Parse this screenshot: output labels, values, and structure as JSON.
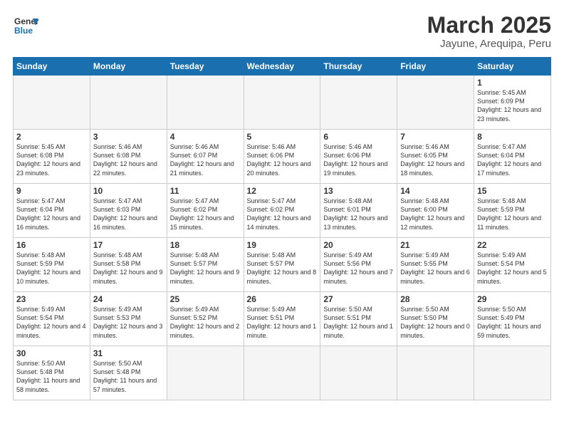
{
  "header": {
    "logo_general": "General",
    "logo_blue": "Blue",
    "month_year": "March 2025",
    "location": "Jayune, Arequipa, Peru"
  },
  "weekdays": [
    "Sunday",
    "Monday",
    "Tuesday",
    "Wednesday",
    "Thursday",
    "Friday",
    "Saturday"
  ],
  "weeks": [
    [
      {
        "day": "",
        "info": ""
      },
      {
        "day": "",
        "info": ""
      },
      {
        "day": "",
        "info": ""
      },
      {
        "day": "",
        "info": ""
      },
      {
        "day": "",
        "info": ""
      },
      {
        "day": "",
        "info": ""
      },
      {
        "day": "1",
        "info": "Sunrise: 5:45 AM\nSunset: 6:09 PM\nDaylight: 12 hours and 23 minutes."
      }
    ],
    [
      {
        "day": "2",
        "info": "Sunrise: 5:45 AM\nSunset: 6:08 PM\nDaylight: 12 hours and 23 minutes."
      },
      {
        "day": "3",
        "info": "Sunrise: 5:46 AM\nSunset: 6:08 PM\nDaylight: 12 hours and 22 minutes."
      },
      {
        "day": "4",
        "info": "Sunrise: 5:46 AM\nSunset: 6:07 PM\nDaylight: 12 hours and 21 minutes."
      },
      {
        "day": "5",
        "info": "Sunrise: 5:46 AM\nSunset: 6:06 PM\nDaylight: 12 hours and 20 minutes."
      },
      {
        "day": "6",
        "info": "Sunrise: 5:46 AM\nSunset: 6:06 PM\nDaylight: 12 hours and 19 minutes."
      },
      {
        "day": "7",
        "info": "Sunrise: 5:46 AM\nSunset: 6:05 PM\nDaylight: 12 hours and 18 minutes."
      },
      {
        "day": "8",
        "info": "Sunrise: 5:47 AM\nSunset: 6:04 PM\nDaylight: 12 hours and 17 minutes."
      }
    ],
    [
      {
        "day": "9",
        "info": "Sunrise: 5:47 AM\nSunset: 6:04 PM\nDaylight: 12 hours and 16 minutes."
      },
      {
        "day": "10",
        "info": "Sunrise: 5:47 AM\nSunset: 6:03 PM\nDaylight: 12 hours and 16 minutes."
      },
      {
        "day": "11",
        "info": "Sunrise: 5:47 AM\nSunset: 6:02 PM\nDaylight: 12 hours and 15 minutes."
      },
      {
        "day": "12",
        "info": "Sunrise: 5:47 AM\nSunset: 6:02 PM\nDaylight: 12 hours and 14 minutes."
      },
      {
        "day": "13",
        "info": "Sunrise: 5:48 AM\nSunset: 6:01 PM\nDaylight: 12 hours and 13 minutes."
      },
      {
        "day": "14",
        "info": "Sunrise: 5:48 AM\nSunset: 6:00 PM\nDaylight: 12 hours and 12 minutes."
      },
      {
        "day": "15",
        "info": "Sunrise: 5:48 AM\nSunset: 5:59 PM\nDaylight: 12 hours and 11 minutes."
      }
    ],
    [
      {
        "day": "16",
        "info": "Sunrise: 5:48 AM\nSunset: 5:59 PM\nDaylight: 12 hours and 10 minutes."
      },
      {
        "day": "17",
        "info": "Sunrise: 5:48 AM\nSunset: 5:58 PM\nDaylight: 12 hours and 9 minutes."
      },
      {
        "day": "18",
        "info": "Sunrise: 5:48 AM\nSunset: 5:57 PM\nDaylight: 12 hours and 9 minutes."
      },
      {
        "day": "19",
        "info": "Sunrise: 5:48 AM\nSunset: 5:57 PM\nDaylight: 12 hours and 8 minutes."
      },
      {
        "day": "20",
        "info": "Sunrise: 5:49 AM\nSunset: 5:56 PM\nDaylight: 12 hours and 7 minutes."
      },
      {
        "day": "21",
        "info": "Sunrise: 5:49 AM\nSunset: 5:55 PM\nDaylight: 12 hours and 6 minutes."
      },
      {
        "day": "22",
        "info": "Sunrise: 5:49 AM\nSunset: 5:54 PM\nDaylight: 12 hours and 5 minutes."
      }
    ],
    [
      {
        "day": "23",
        "info": "Sunrise: 5:49 AM\nSunset: 5:54 PM\nDaylight: 12 hours and 4 minutes."
      },
      {
        "day": "24",
        "info": "Sunrise: 5:49 AM\nSunset: 5:53 PM\nDaylight: 12 hours and 3 minutes."
      },
      {
        "day": "25",
        "info": "Sunrise: 5:49 AM\nSunset: 5:52 PM\nDaylight: 12 hours and 2 minutes."
      },
      {
        "day": "26",
        "info": "Sunrise: 5:49 AM\nSunset: 5:51 PM\nDaylight: 12 hours and 1 minute."
      },
      {
        "day": "27",
        "info": "Sunrise: 5:50 AM\nSunset: 5:51 PM\nDaylight: 12 hours and 1 minute."
      },
      {
        "day": "28",
        "info": "Sunrise: 5:50 AM\nSunset: 5:50 PM\nDaylight: 12 hours and 0 minutes."
      },
      {
        "day": "29",
        "info": "Sunrise: 5:50 AM\nSunset: 5:49 PM\nDaylight: 11 hours and 59 minutes."
      }
    ],
    [
      {
        "day": "30",
        "info": "Sunrise: 5:50 AM\nSunset: 5:48 PM\nDaylight: 11 hours and 58 minutes."
      },
      {
        "day": "31",
        "info": "Sunrise: 5:50 AM\nSunset: 5:48 PM\nDaylight: 11 hours and 57 minutes."
      },
      {
        "day": "",
        "info": ""
      },
      {
        "day": "",
        "info": ""
      },
      {
        "day": "",
        "info": ""
      },
      {
        "day": "",
        "info": ""
      },
      {
        "day": "",
        "info": ""
      }
    ]
  ]
}
